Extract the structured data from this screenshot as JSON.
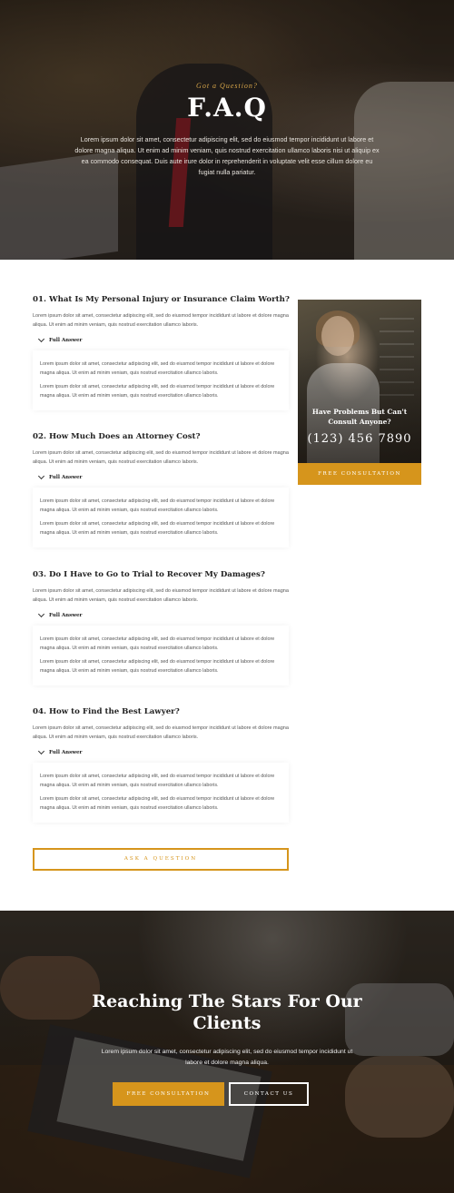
{
  "hero": {
    "eyebrow": "Got a Question?",
    "title": "F.A.Q",
    "text": "Lorem ipsum dolor sit amet, consectetur adipiscing elit, sed do eiusmod tempor incididunt ut labore et dolore magna aliqua. Ut enim ad minim veniam, quis nostrud exercitation ullamco laboris nisi ut aliquip ex ea commodo consequat. Duis aute irure dolor in reprehenderit in voluptate velit esse cillum dolore eu fugiat nulla pariatur."
  },
  "faq": {
    "items": [
      {
        "question": "01. What Is My Personal Injury or Insurance Claim Worth?",
        "lead": "Lorem ipsum dolor sit amet, consectetur adipiscing elit, sed do eiusmod tempor incididunt ut labore et dolore magna aliqua. Ut enim ad minim veniam, quis nostrud exercitation ullamco laboris.",
        "toggle_label": "Full Answer",
        "answer_paragraphs": [
          "Lorem ipsum dolor sit amet, consectetur adipiscing elit, sed do eiusmod tempor incididunt ut labore et dolore magna aliqua. Ut enim ad minim veniam, quis nostrud exercitation ullamco laboris.",
          "Lorem ipsum dolor sit amet, consectetur adipiscing elit, sed do eiusmod tempor incididunt ut labore et dolore magna aliqua. Ut enim ad minim veniam, quis nostrud exercitation ullamco laboris."
        ]
      },
      {
        "question": "02. How Much Does an Attorney Cost?",
        "lead": "Lorem ipsum dolor sit amet, consectetur adipiscing elit, sed do eiusmod tempor incididunt ut labore et dolore magna aliqua. Ut enim ad minim veniam, quis nostrud exercitation ullamco laboris.",
        "toggle_label": "Full Answer",
        "answer_paragraphs": [
          "Lorem ipsum dolor sit amet, consectetur adipiscing elit, sed do eiusmod tempor incididunt ut labore et dolore magna aliqua. Ut enim ad minim veniam, quis nostrud exercitation ullamco laboris.",
          "Lorem ipsum dolor sit amet, consectetur adipiscing elit, sed do eiusmod tempor incididunt ut labore et dolore magna aliqua. Ut enim ad minim veniam, quis nostrud exercitation ullamco laboris."
        ]
      },
      {
        "question": "03. Do I Have to Go to Trial to Recover My Damages?",
        "lead": "Lorem ipsum dolor sit amet, consectetur adipiscing elit, sed do eiusmod tempor incididunt ut labore et dolore magna aliqua. Ut enim ad minim veniam, quis nostrud exercitation ullamco laboris.",
        "toggle_label": "Full Answer",
        "answer_paragraphs": [
          "Lorem ipsum dolor sit amet, consectetur adipiscing elit, sed do eiusmod tempor incididunt ut labore et dolore magna aliqua. Ut enim ad minim veniam, quis nostrud exercitation ullamco laboris.",
          "Lorem ipsum dolor sit amet, consectetur adipiscing elit, sed do eiusmod tempor incididunt ut labore et dolore magna aliqua. Ut enim ad minim veniam, quis nostrud exercitation ullamco laboris."
        ]
      },
      {
        "question": "04. How to Find the Best Lawyer?",
        "lead": "Lorem ipsum dolor sit amet, consectetur adipiscing elit, sed do eiusmod tempor incididunt ut labore et dolore magna aliqua. Ut enim ad minim veniam, quis nostrud exercitation ullamco laboris.",
        "toggle_label": "Full Answer",
        "answer_paragraphs": [
          "Lorem ipsum dolor sit amet, consectetur adipiscing elit, sed do eiusmod tempor incididunt ut labore et dolore magna aliqua. Ut enim ad minim veniam, quis nostrud exercitation ullamco laboris.",
          "Lorem ipsum dolor sit amet, consectetur adipiscing elit, sed do eiusmod tempor incididunt ut labore et dolore magna aliqua. Ut enim ad minim veniam, quis nostrud exercitation ullamco laboris."
        ]
      }
    ],
    "ask_button": "ASK A QUESTION"
  },
  "sidebar": {
    "title": "Have Problems But Can't Consult Anyone?",
    "phone": "(123) 456 7890",
    "button": "FREE CONSULTATION"
  },
  "bottom_cta": {
    "title": "Reaching The Stars For Our Clients",
    "text": "Lorem ipsum dolor sit amet, consectetur adipiscing elit, sed do eiusmod tempor incididunt ut labore et dolore magna aliqua.",
    "primary_button": "FREE CONSULTATION",
    "secondary_button": "CONTACT US"
  },
  "colors": {
    "accent": "#d6951c",
    "eyebrow": "#d7a64a"
  }
}
